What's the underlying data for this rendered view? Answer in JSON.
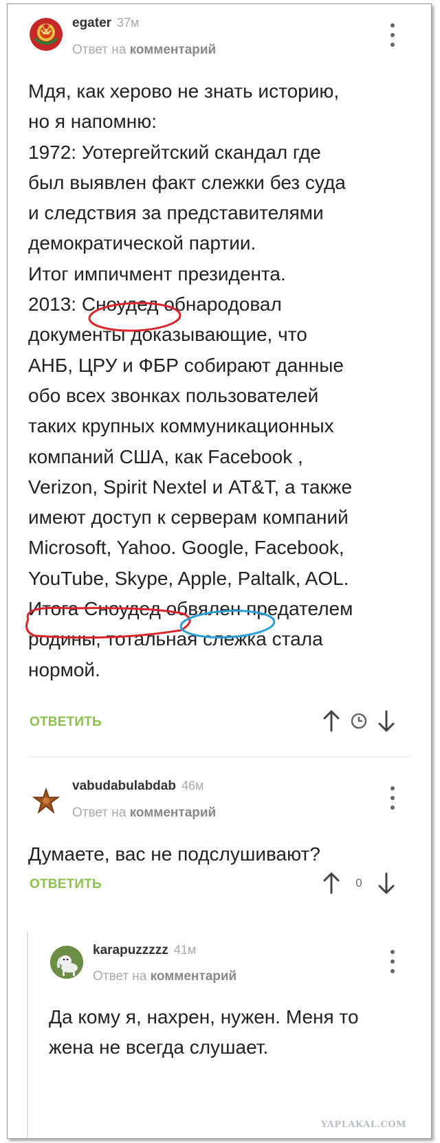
{
  "comments": [
    {
      "author": "egater",
      "age": "37м",
      "reply_prefix": "Ответ на",
      "reply_target": "комментарий",
      "text_lines": [
        "Мдя, как херово не знать историю,",
        "но я напомню:",
        "1972: Уотергейтский скандал где",
        "был выявлен факт слежки без суда",
        "и следствия за представителями",
        "демократической партии.",
        "Итог импичмент президента.",
        "2013: Сноудед обнародовал",
        "документы доказывающие, что",
        "АНБ, ЦРУ и ФБР собирают данные",
        "обо всех звонках пользователей",
        "таких крупных коммуникационных",
        "компаний США, как Facebook ,",
        "Verizon, Spirit Nextel и AT&T, а также",
        "имеют доступ к серверам компаний",
        "Microsoft, Yahoo. Google, Facebook,",
        "YouTube, Skype, Apple, Paltalk, AOL.",
        "Итога Сноудед обвялен предателем",
        "родины, тотальная слежка стала",
        "нормой."
      ],
      "reply_label": "ОТВЕТИТЬ",
      "score": ""
    },
    {
      "author": "vabudabulabdab",
      "age": "46м",
      "reply_prefix": "Ответ на",
      "reply_target": "комментарий",
      "text_lines": [
        "Думаете, вас не подслушивают?"
      ],
      "reply_label": "ОТВЕТИТЬ",
      "score": "0"
    },
    {
      "author": "karapuzzzzz",
      "age": "41м",
      "reply_prefix": "Ответ на",
      "reply_target": "комментарий",
      "text_lines": [
        "Да кому я, нахрен, нужен. Меня то",
        "жена не всегда слушает."
      ]
    }
  ],
  "watermark": "YAPLAKAL.COM",
  "annotation_colors": {
    "red": "#d9252b",
    "blue": "#2a9fd6"
  },
  "accent_color": "#8bc34a",
  "icons": [
    "ussr-emblem-avatar",
    "star-avatar",
    "dog-avatar",
    "more-vert-icon",
    "arrow-up-icon",
    "arrow-down-icon",
    "clock-icon"
  ]
}
